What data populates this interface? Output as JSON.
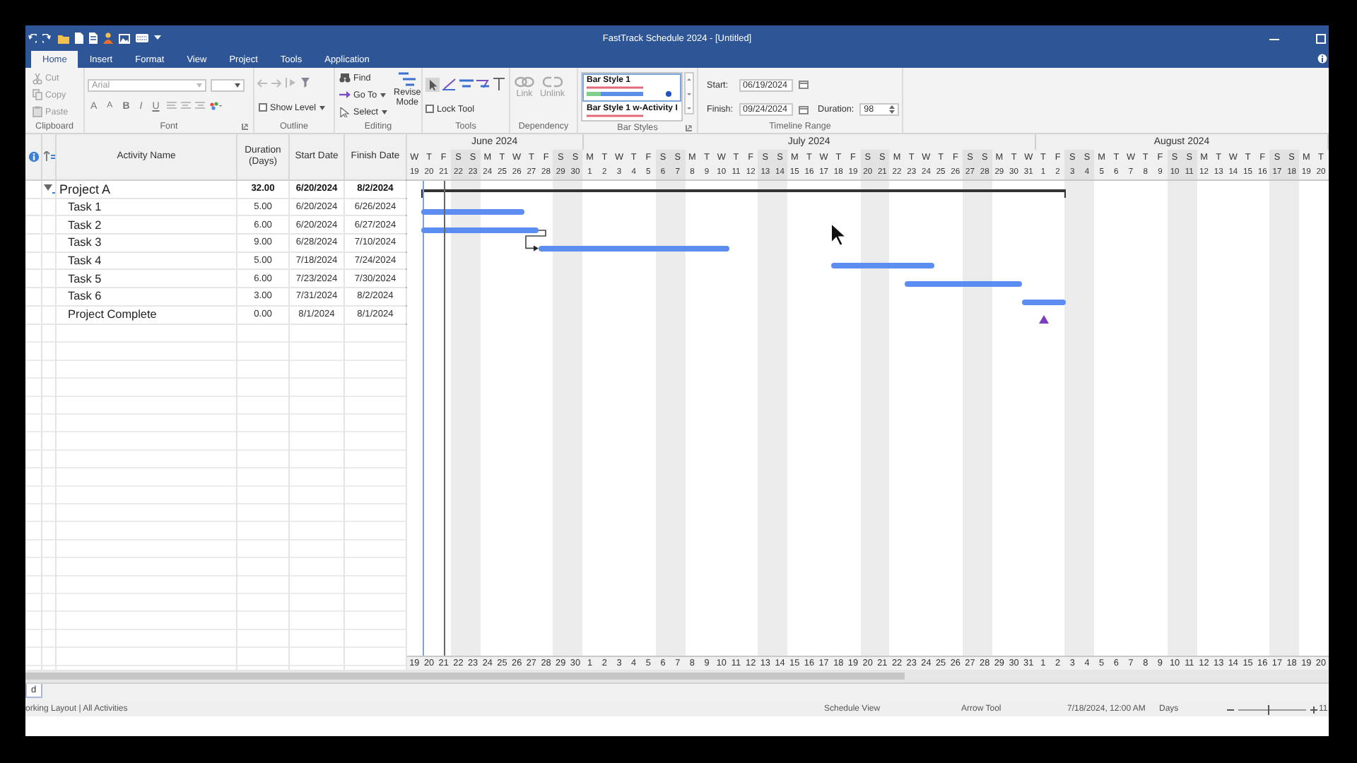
{
  "window": {
    "title": "FastTrack Schedule 2024 - [Untitled]"
  },
  "ribbon_tabs": [
    {
      "label": "Home",
      "selected": true
    },
    {
      "label": "Insert",
      "selected": false
    },
    {
      "label": "Format",
      "selected": false
    },
    {
      "label": "View",
      "selected": false
    },
    {
      "label": "Project",
      "selected": false
    },
    {
      "label": "Tools",
      "selected": false
    },
    {
      "label": "Application",
      "selected": false
    }
  ],
  "ribbon": {
    "clipboard": {
      "label": "Clipboard",
      "buttons": [
        {
          "label": "Cut",
          "kind": "cut",
          "disabled": true
        },
        {
          "label": "Copy",
          "kind": "copy",
          "disabled": true
        },
        {
          "label": "Paste",
          "kind": "paste",
          "disabled": true
        }
      ]
    },
    "font": {
      "label": "Font",
      "font_name": "Arial",
      "format_buttons": [
        {
          "label": "A",
          "kind": "grow"
        },
        {
          "label": "A",
          "kind": "shrink"
        },
        {
          "label": "B",
          "kind": "bold"
        },
        {
          "label": "I",
          "kind": "italic"
        },
        {
          "label": "U",
          "kind": "underline"
        }
      ]
    },
    "outline": {
      "label": "Outline",
      "show_level": "Show Level"
    },
    "editing": {
      "label": "Editing",
      "buttons": [
        {
          "label": "Find",
          "kind": "find"
        },
        {
          "label": "Go To",
          "kind": "goto"
        },
        {
          "label": "Select",
          "kind": "select"
        }
      ],
      "revise": "Revise Mode"
    },
    "tools": {
      "label": "Tools",
      "lock_tool": {
        "label": "Lock Tool",
        "checked": false
      }
    },
    "dependency": {
      "label": "Dependency",
      "buttons": [
        {
          "label": "Link",
          "kind": "link",
          "disabled": true
        },
        {
          "label": "Unlink",
          "kind": "unlink",
          "disabled": true
        }
      ]
    },
    "bar_styles": {
      "label": "Bar Styles",
      "styles": [
        {
          "name": "Bar Style 1",
          "selected": true
        },
        {
          "name": "Bar Style 1 w-Activity I",
          "selected": false
        }
      ]
    },
    "timeline_range": {
      "label": "Timeline Range",
      "start_label": "Start:",
      "start": "06/19/2024",
      "finish_label": "Finish:",
      "finish": "09/24/2024",
      "duration_label": "Duration:",
      "duration": "98"
    }
  },
  "table": {
    "columns": [
      {
        "label": "Activity Name"
      },
      {
        "label": "Duration (Days)"
      },
      {
        "label": "Start Date"
      },
      {
        "label": "Finish Date"
      }
    ],
    "rows": [
      {
        "name": "Project A",
        "kind": "summary",
        "expanded": true,
        "duration": "32.00",
        "start": "6/20/2024",
        "finish": "8/2/2024",
        "children": [
          {
            "name": "Task 1",
            "kind": "task",
            "linked": false,
            "duration": "5.00",
            "start": "6/20/2024",
            "finish": "6/26/2024"
          },
          {
            "name": "Task 2",
            "kind": "task",
            "linked": false,
            "duration": "6.00",
            "start": "6/20/2024",
            "finish": "6/27/2024"
          },
          {
            "name": "Task 3",
            "kind": "task",
            "linked": true,
            "duration": "9.00",
            "start": "6/28/2024",
            "finish": "7/10/2024"
          },
          {
            "name": "Task 4",
            "kind": "task",
            "linked": false,
            "duration": "5.00",
            "start": "7/18/2024",
            "finish": "7/24/2024"
          },
          {
            "name": "Task 5",
            "kind": "task",
            "linked": false,
            "duration": "6.00",
            "start": "7/23/2024",
            "finish": "7/30/2024"
          },
          {
            "name": "Task 6",
            "kind": "task",
            "linked": false,
            "duration": "3.00",
            "start": "7/31/2024",
            "finish": "8/2/2024"
          },
          {
            "name": "Project Complete",
            "kind": "milestone",
            "linked": false,
            "duration": "0.00",
            "start": "8/1/2024",
            "finish": "8/1/2024"
          }
        ]
      }
    ]
  },
  "timeline": {
    "months": [
      {
        "label": "June 2024",
        "days": [
          {
            "letter": "W",
            "number": "19",
            "weekend": false
          },
          {
            "letter": "T",
            "number": "20",
            "weekend": false
          },
          {
            "letter": "F",
            "number": "21",
            "weekend": false
          },
          {
            "letter": "S",
            "number": "22",
            "weekend": true
          },
          {
            "letter": "S",
            "number": "23",
            "weekend": true
          },
          {
            "letter": "M",
            "number": "24",
            "weekend": false
          },
          {
            "letter": "T",
            "number": "25",
            "weekend": false
          },
          {
            "letter": "W",
            "number": "26",
            "weekend": false
          },
          {
            "letter": "T",
            "number": "27",
            "weekend": false
          },
          {
            "letter": "F",
            "number": "28",
            "weekend": false
          },
          {
            "letter": "S",
            "number": "29",
            "weekend": true
          },
          {
            "letter": "S",
            "number": "30",
            "weekend": true
          }
        ]
      },
      {
        "label": "July 2024",
        "days": [
          {
            "letter": "M",
            "number": "1",
            "weekend": false
          },
          {
            "letter": "T",
            "number": "2",
            "weekend": false
          },
          {
            "letter": "W",
            "number": "3",
            "weekend": false
          },
          {
            "letter": "T",
            "number": "4",
            "weekend": false
          },
          {
            "letter": "F",
            "number": "5",
            "weekend": false
          },
          {
            "letter": "S",
            "number": "6",
            "weekend": true
          },
          {
            "letter": "S",
            "number": "7",
            "weekend": true
          },
          {
            "letter": "M",
            "number": "8",
            "weekend": false
          },
          {
            "letter": "T",
            "number": "9",
            "weekend": false
          },
          {
            "letter": "W",
            "number": "10",
            "weekend": false
          },
          {
            "letter": "T",
            "number": "11",
            "weekend": false
          },
          {
            "letter": "F",
            "number": "12",
            "weekend": false
          },
          {
            "letter": "S",
            "number": "13",
            "weekend": true
          },
          {
            "letter": "S",
            "number": "14",
            "weekend": true
          },
          {
            "letter": "M",
            "number": "15",
            "weekend": false
          },
          {
            "letter": "T",
            "number": "16",
            "weekend": false
          },
          {
            "letter": "W",
            "number": "17",
            "weekend": false
          },
          {
            "letter": "T",
            "number": "18",
            "weekend": false
          },
          {
            "letter": "F",
            "number": "19",
            "weekend": false
          },
          {
            "letter": "S",
            "number": "20",
            "weekend": true
          },
          {
            "letter": "S",
            "number": "21",
            "weekend": true
          },
          {
            "letter": "M",
            "number": "22",
            "weekend": false
          },
          {
            "letter": "T",
            "number": "23",
            "weekend": false
          },
          {
            "letter": "W",
            "number": "24",
            "weekend": false
          },
          {
            "letter": "T",
            "number": "25",
            "weekend": false
          },
          {
            "letter": "F",
            "number": "26",
            "weekend": false
          },
          {
            "letter": "S",
            "number": "27",
            "weekend": true
          },
          {
            "letter": "S",
            "number": "28",
            "weekend": true
          },
          {
            "letter": "M",
            "number": "29",
            "weekend": false
          },
          {
            "letter": "T",
            "number": "30",
            "weekend": false
          },
          {
            "letter": "W",
            "number": "31",
            "weekend": false
          }
        ]
      },
      {
        "label": "August 2024",
        "days": [
          {
            "letter": "T",
            "number": "1",
            "weekend": false
          },
          {
            "letter": "F",
            "number": "2",
            "weekend": false
          },
          {
            "letter": "S",
            "number": "3",
            "weekend": true
          },
          {
            "letter": "S",
            "number": "4",
            "weekend": true
          },
          {
            "letter": "M",
            "number": "5",
            "weekend": false
          },
          {
            "letter": "T",
            "number": "6",
            "weekend": false
          },
          {
            "letter": "W",
            "number": "7",
            "weekend": false
          },
          {
            "letter": "T",
            "number": "8",
            "weekend": false
          },
          {
            "letter": "F",
            "number": "9",
            "weekend": false
          },
          {
            "letter": "S",
            "number": "10",
            "weekend": true
          },
          {
            "letter": "S",
            "number": "11",
            "weekend": true
          },
          {
            "letter": "M",
            "number": "12",
            "weekend": false
          },
          {
            "letter": "T",
            "number": "13",
            "weekend": false
          },
          {
            "letter": "W",
            "number": "14",
            "weekend": false
          },
          {
            "letter": "T",
            "number": "15",
            "weekend": false
          },
          {
            "letter": "F",
            "number": "16",
            "weekend": false
          },
          {
            "letter": "S",
            "number": "17",
            "weekend": true
          },
          {
            "letter": "S",
            "number": "18",
            "weekend": true
          },
          {
            "letter": "M",
            "number": "19",
            "weekend": false
          },
          {
            "letter": "T",
            "number": "20",
            "weekend": false
          }
        ]
      }
    ],
    "footer_days": [
      "19",
      "20",
      "21",
      "22",
      "23",
      "24",
      "25",
      "26",
      "27",
      "28",
      "29",
      "30",
      "1",
      "2",
      "3",
      "4",
      "5",
      "6",
      "7",
      "8",
      "9",
      "10",
      "11",
      "12",
      "13",
      "14",
      "15",
      "16",
      "17",
      "18",
      "19",
      "20",
      "21",
      "22",
      "23",
      "24",
      "25",
      "26",
      "27",
      "28",
      "29",
      "30",
      "31",
      "1",
      "2",
      "3",
      "4",
      "5",
      "6",
      "7",
      "8",
      "9",
      "10",
      "11",
      "12",
      "13",
      "14",
      "15",
      "16",
      "17",
      "18",
      "19",
      "20"
    ]
  },
  "sheet_tabs": [
    {
      "label": "d",
      "selected": true
    }
  ],
  "status_bar": {
    "layout": "orking Layout | All Activities",
    "view": "Schedule View",
    "tool": "Arrow Tool",
    "date": "7/18/2024, 12:00 AM",
    "unit": "Days",
    "zoom_slider": {
      "level": 0.45
    },
    "zoom_text": "11"
  }
}
